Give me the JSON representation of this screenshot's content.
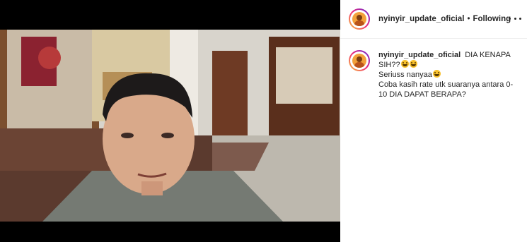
{
  "post": {
    "username": "nyinyir_update_oficial",
    "separator": "•",
    "follow_status": "Following",
    "more_label": "More options"
  },
  "caption": {
    "username": "nyinyir_update_oficial",
    "line1": "DIA KENAPA SIH??",
    "line1_emoji_count": 2,
    "line2": "Seriuss nanyaa",
    "line2_emoji_count": 1,
    "line3": "Coba kasih rate utk suaranya antara 0-10 DIA DAPAT BERAPA?"
  },
  "icons": {
    "avatar": "profile-avatar",
    "emoji": "grinning-sweat-emoji",
    "more": "horizontal-ellipsis-icon"
  }
}
